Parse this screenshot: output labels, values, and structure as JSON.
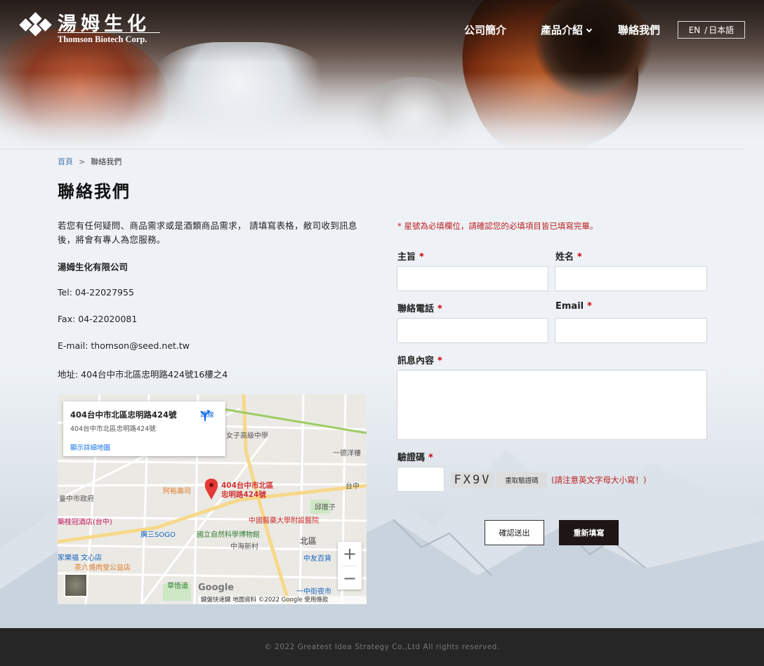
{
  "brand": {
    "name_cn": "湯姆生化",
    "name_en": "Thomson Biotech Corp."
  },
  "nav": {
    "items": [
      {
        "label": "公司簡介"
      },
      {
        "label": "產品介紹"
      },
      {
        "label": "聯絡我們"
      }
    ],
    "lang_en": "EN",
    "lang_sep": "/",
    "lang_jp": "日本語"
  },
  "breadcrumb": {
    "home": "首頁",
    "sep": ">",
    "current": "聯絡我們"
  },
  "page_title": "聯絡我們",
  "contact": {
    "intro": "若您有任何疑問、商品需求或是酒類商品需求， 請填寫表格，敝司收到訊息後，將會有專人為您服務。",
    "company": "湯姆生化有限公司",
    "tel": "Tel: 04-22027955",
    "fax": "Fax: 04-22020081",
    "email": "E-mail: thomson@seed.net.tw",
    "address": "地址: 404台中市北區忠明路424號16樓之4"
  },
  "map": {
    "card_title": "404台中市北區忠明路424號",
    "card_subtitle": "404台中市北區忠明路424號",
    "card_link": "顯示詳細地圖",
    "directions_label": "路線",
    "pin_label_1": "404台中市北區",
    "pin_label_2": "忠明路424號",
    "zoom_in": "+",
    "zoom_out": "−",
    "google": "Google",
    "footer": "鍵盤快速鍵  地圖資料 ©2022 Google  使用條款",
    "places": {
      "school": "女子高級中學",
      "restaurant": "阿裕壽司",
      "gov": "臺中市政府",
      "hotel": "築桂冠酒店(台中)",
      "sogo": "廣三SOGO",
      "museum": "國立自然科學博物館",
      "hospital": "中國醫藥大學附設醫院",
      "district": "北區",
      "village": "中海新村",
      "dept": "中友百貨",
      "carrefour": "家樂福 文心店",
      "hotpot": "茶六燒肉堂公益店",
      "park": "草悟道",
      "night": "一中街夜市",
      "deyang": "一德洋樓",
      "zhongtai": "台中",
      "yimg": "邱厝子"
    }
  },
  "form": {
    "required_note": "* 星號為必填欄位，請確認您的必填項目皆已填寫完畢。",
    "subject_label": "主旨",
    "name_label": "姓名",
    "phone_label": "聯絡電話",
    "email_label": "Email",
    "message_label": "訊息內容",
    "captcha_label": "驗證碼",
    "required_mark": "*",
    "captcha_text": "FX9V",
    "refresh_label": "重取驗證碼",
    "captcha_note": "(請注意英文字母大小寫！)",
    "submit_label": "確認送出",
    "reset_label": "重新填寫"
  },
  "footer": {
    "copyright": "© 2022 Greatest Idea Strategy Co.,Ltd All rights reserved."
  }
}
